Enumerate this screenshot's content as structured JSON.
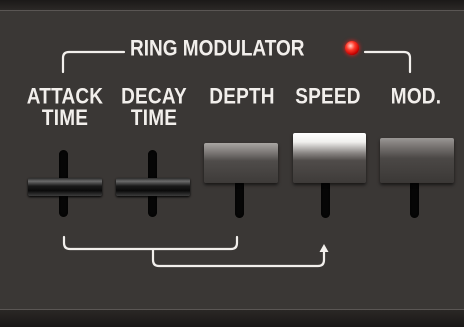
{
  "section": {
    "title": "RING MODULATOR",
    "led_color": "#ff2a1a",
    "led_state": "on"
  },
  "sliders": [
    {
      "id": "attack-time",
      "label_line1": "ATTACK",
      "label_line2": "TIME"
    },
    {
      "id": "decay-time",
      "label_line1": "DECAY",
      "label_line2": "TIME"
    },
    {
      "id": "depth",
      "label_line1": "DEPTH",
      "label_line2": ""
    },
    {
      "id": "speed",
      "label_line1": "SPEED",
      "label_line2": ""
    },
    {
      "id": "mod",
      "label_line1": "MOD.",
      "label_line2": ""
    }
  ],
  "colors": {
    "panel": "#3a3735",
    "text": "#f2efec",
    "slot": "#060606"
  }
}
